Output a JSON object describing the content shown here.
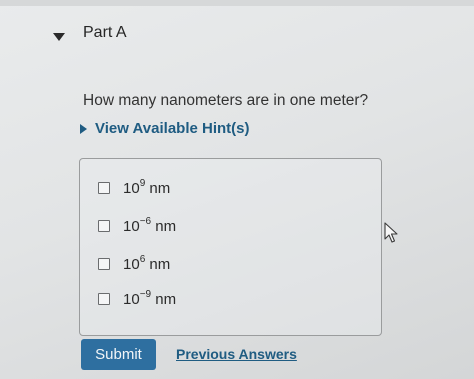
{
  "part": {
    "title": "Part A",
    "toggle_icon": "caret-down-icon"
  },
  "question": {
    "text": "How many nanometers are in one meter?"
  },
  "hints": {
    "label": "View Available Hint(s)",
    "icon": "caret-right-icon"
  },
  "options": [
    {
      "base": "10",
      "exponent": "9",
      "unit": " nm",
      "checked": false
    },
    {
      "base": "10",
      "exponent": "−6",
      "unit": " nm",
      "checked": false
    },
    {
      "base": "10",
      "exponent": "6",
      "unit": " nm",
      "checked": false
    },
    {
      "base": "10",
      "exponent": "−9",
      "unit": " nm",
      "checked": false
    }
  ],
  "actions": {
    "submit_label": "Submit",
    "previous_answers_label": "Previous Answers"
  },
  "colors": {
    "accent": "#2e6fa0",
    "link": "#1f5c82"
  }
}
